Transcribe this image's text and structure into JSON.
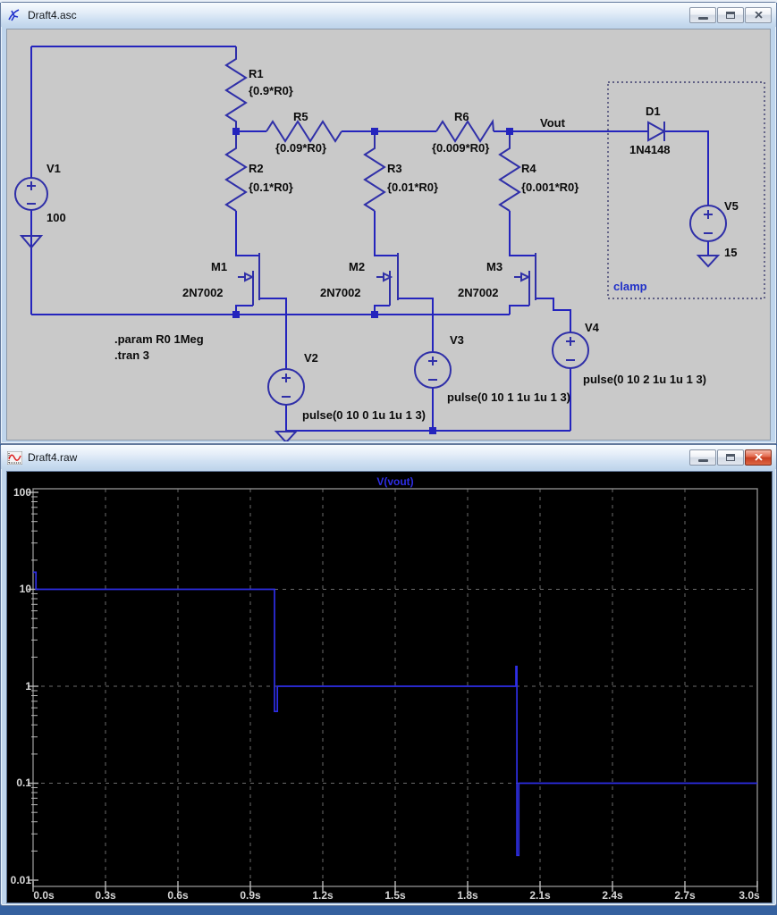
{
  "window_schematic": {
    "title": "Draft4.asc",
    "net_label": "Vout",
    "annotation": "clamp",
    "directives": [
      ".param R0 1Meg",
      ".tran 3"
    ],
    "components": {
      "v1": {
        "name": "V1",
        "value": "100"
      },
      "r1": {
        "name": "R1",
        "value": "{0.9*R0}"
      },
      "r2": {
        "name": "R2",
        "value": "{0.1*R0}"
      },
      "r3": {
        "name": "R3",
        "value": "{0.01*R0}"
      },
      "r4": {
        "name": "R4",
        "value": "{0.001*R0}"
      },
      "r5": {
        "name": "R5",
        "value": "{0.09*R0}"
      },
      "r6": {
        "name": "R6",
        "value": "{0.009*R0}"
      },
      "m1": {
        "name": "M1",
        "value": "2N7002"
      },
      "m2": {
        "name": "M2",
        "value": "2N7002"
      },
      "m3": {
        "name": "M3",
        "value": "2N7002"
      },
      "v2": {
        "name": "V2",
        "value": "pulse(0 10 0 1u 1u 1 3)"
      },
      "v3": {
        "name": "V3",
        "value": "pulse(0 10 1 1u 1u 1 3)"
      },
      "v4": {
        "name": "V4",
        "value": "pulse(0 10 2 1u 1u 1 3)"
      },
      "d1": {
        "name": "D1",
        "value": "1N4148"
      },
      "v5": {
        "name": "V5",
        "value": "15"
      }
    }
  },
  "window_waveform": {
    "title": "Draft4.raw",
    "trace_label": "V(vout)",
    "y_ticks": [
      "100",
      "10",
      "1",
      "0.1",
      "0.01"
    ],
    "x_ticks": [
      "0.0s",
      "0.3s",
      "0.6s",
      "0.9s",
      "1.2s",
      "1.5s",
      "1.8s",
      "2.1s",
      "2.4s",
      "2.7s",
      "3.0s"
    ],
    "chart_data": {
      "type": "line",
      "title": "V(vout)",
      "x_unit": "s",
      "y_scale": "log",
      "xlim": [
        0,
        3
      ],
      "ylim": [
        0.01,
        100
      ],
      "grid": true,
      "series": [
        {
          "name": "V(vout)",
          "color": "#2e2ee6",
          "points": [
            [
              0,
              15
            ],
            [
              0.012,
              15
            ],
            [
              0.012,
              10
            ],
            [
              1.0,
              10
            ],
            [
              1.0,
              0.55
            ],
            [
              1.012,
              0.55
            ],
            [
              1.012,
              1.0
            ],
            [
              2.0,
              1.0
            ],
            [
              2.0,
              1.6
            ],
            [
              2.004,
              1.6
            ],
            [
              2.004,
              0.018
            ],
            [
              2.012,
              0.018
            ],
            [
              2.012,
              0.1
            ],
            [
              3.0,
              0.1
            ]
          ]
        }
      ]
    }
  }
}
